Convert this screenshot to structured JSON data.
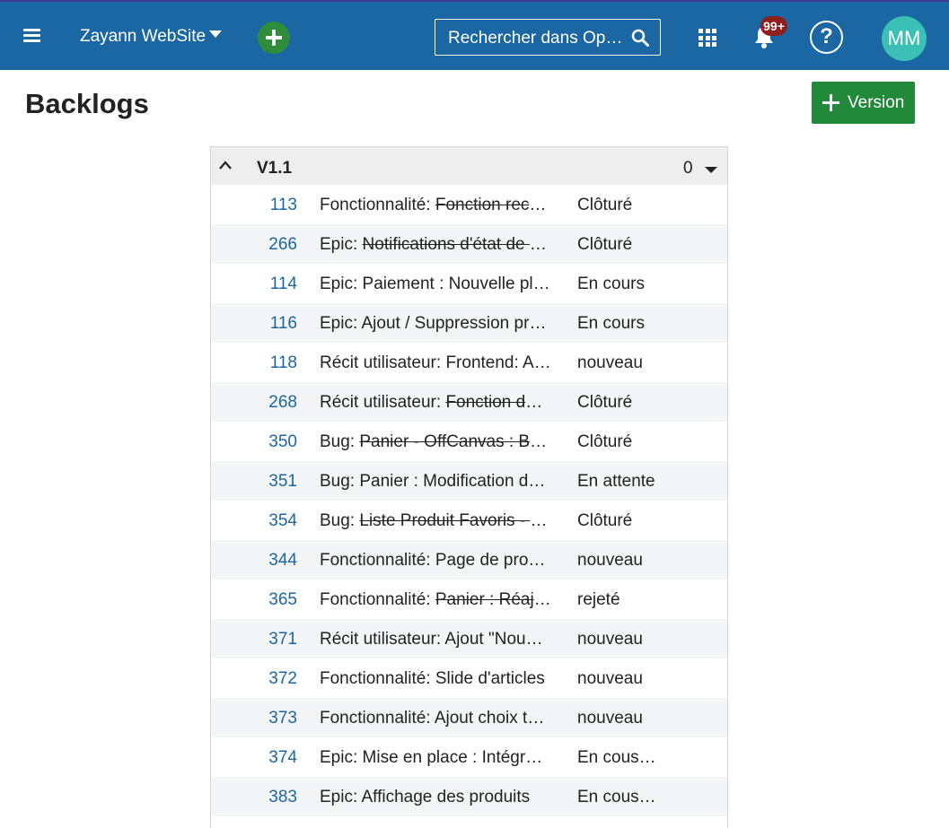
{
  "header": {
    "project_name": "Zayann WebSite",
    "search_placeholder": "Rechercher dans OpenProject",
    "notification_badge": "99+",
    "help_label": "?",
    "avatar_initials": "MM"
  },
  "page": {
    "title": "Backlogs",
    "version_button_label": "Version"
  },
  "backlog": {
    "version_name": "V1.1",
    "story_points": "0",
    "rows": [
      {
        "id": "113",
        "type": "Fonctionnalité:",
        "title": "Fonction recherche",
        "strike": true,
        "status": "Clôturé"
      },
      {
        "id": "266",
        "type": "Epic:",
        "title": "Notifications d'état de commande",
        "strike": true,
        "status": "Clôturé"
      },
      {
        "id": "114",
        "type": "Epic:",
        "title": "Paiement : Nouvelle plateforme",
        "strike": false,
        "status": "En cours"
      },
      {
        "id": "116",
        "type": "Epic:",
        "title": "Ajout / Suppression produits",
        "strike": false,
        "status": "En cours"
      },
      {
        "id": "118",
        "type": "Récit utilisateur:",
        "title": "Frontend: Affichage",
        "strike": false,
        "status": "nouveau"
      },
      {
        "id": "268",
        "type": "Récit utilisateur:",
        "title": "Fonction de tri",
        "strike": true,
        "status": "Clôturé"
      },
      {
        "id": "350",
        "type": "Bug:",
        "title": "Panier - OffCanvas : Bouton",
        "strike": true,
        "status": "Clôturé"
      },
      {
        "id": "351",
        "type": "Bug:",
        "title": "Panier : Modification de quantité",
        "strike": false,
        "status": "En attente"
      },
      {
        "id": "354",
        "type": "Bug:",
        "title": "Liste Produit Favoris - Suppression",
        "strike": true,
        "status": "Clôturé"
      },
      {
        "id": "344",
        "type": "Fonctionnalité:",
        "title": "Page de produit",
        "strike": false,
        "status": "nouveau"
      },
      {
        "id": "365",
        "type": "Fonctionnalité:",
        "title": "Panier : Réajustement",
        "strike": true,
        "status": "rejeté"
      },
      {
        "id": "371",
        "type": "Récit utilisateur:",
        "title": "Ajout \"Nouveautés\"",
        "strike": false,
        "status": "nouveau"
      },
      {
        "id": "372",
        "type": "Fonctionnalité:",
        "title": "Slide d'articles",
        "strike": false,
        "status": "nouveau"
      },
      {
        "id": "373",
        "type": "Fonctionnalité:",
        "title": "Ajout choix taille",
        "strike": false,
        "status": "nouveau"
      },
      {
        "id": "374",
        "type": "Epic:",
        "title": "Mise en place : Intégration",
        "strike": false,
        "status": "En cous de test"
      },
      {
        "id": "383",
        "type": "Epic:",
        "title": "Affichage des produits",
        "strike": false,
        "status": "En cous de test"
      }
    ]
  }
}
